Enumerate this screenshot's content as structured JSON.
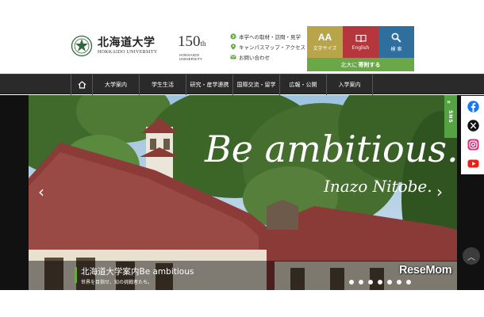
{
  "header": {
    "logo_jp": "北海道大学",
    "logo_en": "HOKKAIDO UNIVERSITY",
    "anniv_num": "150",
    "anniv_suffix": "th",
    "anniv_sub": "HOKKAIDO UNIVERSITY",
    "quick_links": [
      {
        "label": "本学への取材・訪問・見学",
        "icon": "arrow-circle-icon"
      },
      {
        "label": "キャンパスマップ・アクセス",
        "icon": "map-pin-icon"
      },
      {
        "label": "お問い合わせ",
        "icon": "mail-icon"
      }
    ],
    "tools": {
      "font_glyph": "AA",
      "font_label": "文字サイズ",
      "english_label": "English",
      "search_label": "検 索"
    },
    "donate_pre": "北大に",
    "donate_bold": "寄附する"
  },
  "nav": {
    "items": [
      "大学案内",
      "学生生活",
      "研究・産学連携",
      "国際交流・留学",
      "広報・公開",
      "入学案内"
    ]
  },
  "hero": {
    "headline": "Be ambitious.",
    "signature": "Inazo Nitobe.",
    "caption_title": "北海道大学案内Be ambitious",
    "caption_sub": "世界を目指せ、知の挑戦者たち。",
    "slide_count": 7
  },
  "sns": {
    "label": "SNS",
    "icons": [
      "facebook-icon",
      "x-icon",
      "instagram-icon",
      "youtube-icon"
    ]
  },
  "watermark": "ReseMom",
  "colors": {
    "font_tool": "#b8a449",
    "english_tool": "#b5373c",
    "search_tool": "#2e6f9e",
    "donate": "#6aa746",
    "nav": "#2a2a2a"
  }
}
